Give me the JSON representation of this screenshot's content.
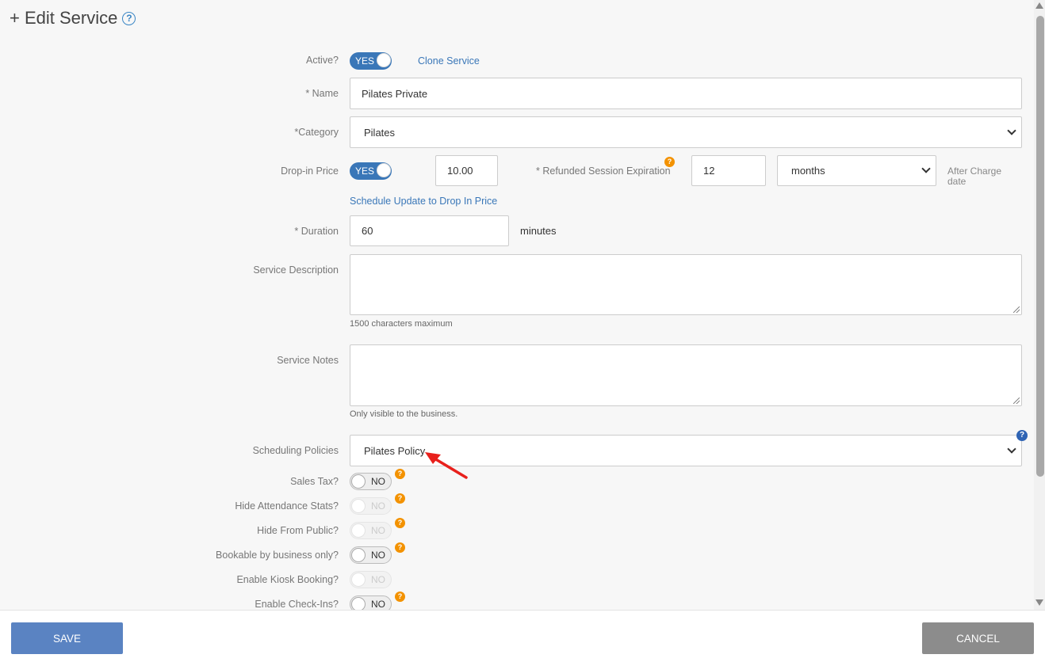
{
  "header": {
    "plus": "+",
    "title": "Edit Service",
    "help": "?"
  },
  "fields": {
    "active_label": "Active?",
    "active_toggle": "YES",
    "clone_link": "Clone Service",
    "name_label": "* Name",
    "name_value": "Pilates Private",
    "category_label": "*Category",
    "category_value": "Pilates",
    "dropin_label": "Drop-in Price",
    "dropin_toggle": "YES",
    "dropin_price": "10.00",
    "refund_label": "* Refunded Session Expiration",
    "refund_value": "12",
    "refund_unit": "months",
    "after_charge": "After Charge date",
    "schedule_link": "Schedule Update to Drop In Price",
    "duration_label": "* Duration",
    "duration_value": "60",
    "duration_unit": "minutes",
    "description_label": "Service Description",
    "description_value": "",
    "description_hint": "1500 characters maximum",
    "notes_label": "Service Notes",
    "notes_value": "",
    "notes_hint": "Only visible to the business.",
    "policies_label": "Scheduling Policies",
    "policies_value": "Pilates Policy"
  },
  "toggles": [
    {
      "label": "Sales Tax?",
      "value": "NO",
      "disabled": false,
      "help": true
    },
    {
      "label": "Hide Attendance Stats?",
      "value": "NO",
      "disabled": true,
      "help": true
    },
    {
      "label": "Hide From Public?",
      "value": "NO",
      "disabled": true,
      "help": true
    },
    {
      "label": "Bookable by business only?",
      "value": "NO",
      "disabled": false,
      "help": true
    },
    {
      "label": "Enable Kiosk Booking?",
      "value": "NO",
      "disabled": true,
      "help": false
    },
    {
      "label": "Enable Check-Ins?",
      "value": "NO",
      "disabled": false,
      "help": true
    }
  ],
  "footer": {
    "save": "SAVE",
    "cancel": "CANCEL"
  },
  "icons": {
    "help_orange": "?",
    "help_blue": "?"
  },
  "colors": {
    "accent": "#3a77b8",
    "help": "#f39200",
    "annotation_arrow": "#e8201c"
  }
}
